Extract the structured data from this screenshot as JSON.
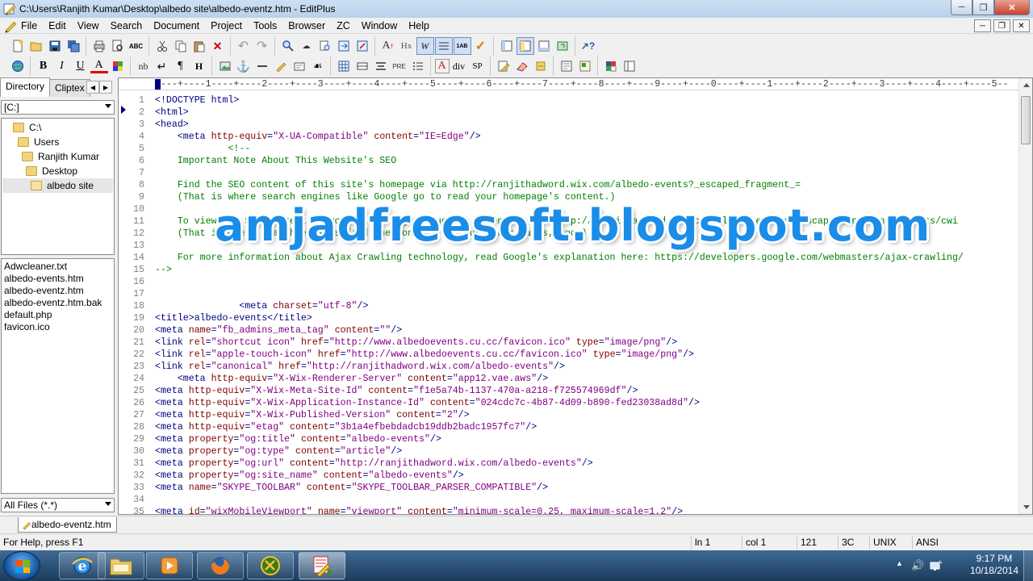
{
  "window": {
    "title": "C:\\Users\\Ranjith Kumar\\Desktop\\albedo site\\albedo-eventz.htm - EditPlus"
  },
  "menu": [
    "File",
    "Edit",
    "View",
    "Search",
    "Document",
    "Project",
    "Tools",
    "Browser",
    "ZC",
    "Window",
    "Help"
  ],
  "toolbar2_text": {
    "bold": "B",
    "italic": "I",
    "underline": "U",
    "font_color": "A",
    "nbsp": "nb",
    "br": "↵",
    "para": "¶",
    "heading": "H",
    "pre": "PRE",
    "div": "div",
    "span": "SP",
    "heading_a": "A",
    "hx": "Hx"
  },
  "left_panel": {
    "tabs": [
      "Directory",
      "Cliptex"
    ],
    "drive": "[C:]",
    "tree": [
      {
        "label": "C:\\",
        "level": 0
      },
      {
        "label": "Users",
        "level": 1
      },
      {
        "label": "Ranjith Kumar",
        "level": 2
      },
      {
        "label": "Desktop",
        "level": 3
      },
      {
        "label": "albedo site",
        "level": 4,
        "selected": true
      }
    ],
    "files": [
      "Adwcleaner.txt",
      "albedo-events.htm",
      "albedo-eventz.htm",
      "albedo-eventz.htm.bak",
      "default.php",
      "favicon.ico"
    ],
    "filter": "All Files (*.*)"
  },
  "editor": {
    "ruler": "----+----1----+----2----+----3----+----4----+----5----+----6----+----7----+----8----+----9----+----0----+----1----+----2----+----3----+----4----+----5--",
    "lines": [
      {
        "n": "1",
        "segs": [
          [
            "tag",
            "<!DOCTYPE html>"
          ]
        ]
      },
      {
        "n": "2",
        "segs": [
          [
            "tag",
            "<html>"
          ]
        ]
      },
      {
        "n": "3",
        "segs": [
          [
            "tag",
            "<head>"
          ]
        ]
      },
      {
        "n": "4",
        "segs": [
          [
            "txt",
            "    "
          ],
          [
            "tag",
            "<meta "
          ],
          [
            "attr",
            "http-equiv"
          ],
          [
            "tag",
            "="
          ],
          [
            "val",
            "\"X-UA-Compatible\""
          ],
          [
            "tag",
            " "
          ],
          [
            "attr",
            "content"
          ],
          [
            "tag",
            "="
          ],
          [
            "val",
            "\"IE=Edge\""
          ],
          [
            "tag",
            "/>"
          ]
        ]
      },
      {
        "n": "5",
        "segs": [
          [
            "com",
            "             <!--"
          ]
        ]
      },
      {
        "n": "6",
        "segs": [
          [
            "com",
            "    Important Note About This Website's SEO"
          ]
        ]
      },
      {
        "n": "7",
        "segs": [
          [
            "com",
            ""
          ]
        ]
      },
      {
        "n": "8",
        "segs": [
          [
            "com",
            "    Find the SEO content of this site's homepage via http://ranjithadword.wix.com/albedo-events?_escaped_fragment_="
          ]
        ]
      },
      {
        "n": "9",
        "segs": [
          [
            "com",
            "    (That is where search engines like Google go to read your homepage's content.)"
          ]
        ]
      },
      {
        "n": "10",
        "segs": [
          [
            "com",
            ""
          ]
        ]
      },
      {
        "n": "11",
        "segs": [
          [
            "com",
            "    To view the SEO content of your other pages, such as \"Events\", use http://ranjithadword.wix.com/albedo-events?_escaped_fragment_=events/cwi"
          ]
        ]
      },
      {
        "n": "12",
        "segs": [
          [
            "com",
            "    (That is where search engines find the content of your other pages, too.)"
          ]
        ]
      },
      {
        "n": "13",
        "segs": [
          [
            "com",
            ""
          ]
        ]
      },
      {
        "n": "14",
        "segs": [
          [
            "com",
            "    For more information about Ajax Crawling technology, read Google's explanation here: https://developers.google.com/webmasters/ajax-crawling/"
          ]
        ]
      },
      {
        "n": "15",
        "segs": [
          [
            "com",
            "-->"
          ]
        ]
      },
      {
        "n": "16",
        "segs": [
          [
            "txt",
            ""
          ]
        ]
      },
      {
        "n": "17",
        "segs": [
          [
            "txt",
            ""
          ]
        ]
      },
      {
        "n": "18",
        "segs": [
          [
            "txt",
            "               "
          ],
          [
            "tag",
            "<meta "
          ],
          [
            "attr",
            "charset"
          ],
          [
            "tag",
            "="
          ],
          [
            "val",
            "\"utf-8\""
          ],
          [
            "tag",
            "/>"
          ]
        ]
      },
      {
        "n": "19",
        "segs": [
          [
            "tag",
            "<title>"
          ],
          [
            "txt",
            "albedo-events"
          ],
          [
            "tag",
            "</title>"
          ]
        ]
      },
      {
        "n": "20",
        "segs": [
          [
            "tag",
            "<meta "
          ],
          [
            "attr",
            "name"
          ],
          [
            "tag",
            "="
          ],
          [
            "val",
            "\"fb_admins_meta_tag\""
          ],
          [
            "tag",
            " "
          ],
          [
            "attr",
            "content"
          ],
          [
            "tag",
            "="
          ],
          [
            "val",
            "\"\""
          ],
          [
            "tag",
            "/>"
          ]
        ]
      },
      {
        "n": "21",
        "segs": [
          [
            "tag",
            "<link "
          ],
          [
            "attr",
            "rel"
          ],
          [
            "tag",
            "="
          ],
          [
            "val",
            "\"shortcut icon\""
          ],
          [
            "tag",
            " "
          ],
          [
            "attr",
            "href"
          ],
          [
            "tag",
            "="
          ],
          [
            "val",
            "\"http://www.albedoevents.cu.cc/favicon.ico\""
          ],
          [
            "tag",
            " "
          ],
          [
            "attr",
            "type"
          ],
          [
            "tag",
            "="
          ],
          [
            "val",
            "\"image/png\""
          ],
          [
            "tag",
            "/>"
          ]
        ]
      },
      {
        "n": "22",
        "segs": [
          [
            "tag",
            "<link "
          ],
          [
            "attr",
            "rel"
          ],
          [
            "tag",
            "="
          ],
          [
            "val",
            "\"apple-touch-icon\""
          ],
          [
            "tag",
            " "
          ],
          [
            "attr",
            "href"
          ],
          [
            "tag",
            "="
          ],
          [
            "val",
            "\"http://www.albedoevents.cu.cc/favicon.ico\""
          ],
          [
            "tag",
            " "
          ],
          [
            "attr",
            "type"
          ],
          [
            "tag",
            "="
          ],
          [
            "val",
            "\"image/png\""
          ],
          [
            "tag",
            "/>"
          ]
        ]
      },
      {
        "n": "23",
        "segs": [
          [
            "tag",
            "<link "
          ],
          [
            "attr",
            "rel"
          ],
          [
            "tag",
            "="
          ],
          [
            "val",
            "\"canonical\""
          ],
          [
            "tag",
            " "
          ],
          [
            "attr",
            "href"
          ],
          [
            "tag",
            "="
          ],
          [
            "val",
            "\"http://ranjithadword.wix.com/albedo-events\""
          ],
          [
            "tag",
            "/>"
          ]
        ]
      },
      {
        "n": "24",
        "segs": [
          [
            "txt",
            "    "
          ],
          [
            "tag",
            "<meta "
          ],
          [
            "attr",
            "http-equiv"
          ],
          [
            "tag",
            "="
          ],
          [
            "val",
            "\"X-Wix-Renderer-Server\""
          ],
          [
            "tag",
            " "
          ],
          [
            "attr",
            "content"
          ],
          [
            "tag",
            "="
          ],
          [
            "val",
            "\"app12.vae.aws\""
          ],
          [
            "tag",
            "/>"
          ]
        ]
      },
      {
        "n": "25",
        "segs": [
          [
            "tag",
            "<meta "
          ],
          [
            "attr",
            "http-equiv"
          ],
          [
            "tag",
            "="
          ],
          [
            "val",
            "\"X-Wix-Meta-Site-Id\""
          ],
          [
            "tag",
            " "
          ],
          [
            "attr",
            "content"
          ],
          [
            "tag",
            "="
          ],
          [
            "val",
            "\"f1e5a74b-1137-470a-a218-f725574969df\""
          ],
          [
            "tag",
            "/>"
          ]
        ]
      },
      {
        "n": "26",
        "segs": [
          [
            "tag",
            "<meta "
          ],
          [
            "attr",
            "http-equiv"
          ],
          [
            "tag",
            "="
          ],
          [
            "val",
            "\"X-Wix-Application-Instance-Id\""
          ],
          [
            "tag",
            " "
          ],
          [
            "attr",
            "content"
          ],
          [
            "tag",
            "="
          ],
          [
            "val",
            "\"024cdc7c-4b87-4d09-b890-fed23038ad8d\""
          ],
          [
            "tag",
            "/>"
          ]
        ]
      },
      {
        "n": "27",
        "segs": [
          [
            "tag",
            "<meta "
          ],
          [
            "attr",
            "http-equiv"
          ],
          [
            "tag",
            "="
          ],
          [
            "val",
            "\"X-Wix-Published-Version\""
          ],
          [
            "tag",
            " "
          ],
          [
            "attr",
            "content"
          ],
          [
            "tag",
            "="
          ],
          [
            "val",
            "\"2\""
          ],
          [
            "tag",
            "/>"
          ]
        ]
      },
      {
        "n": "28",
        "segs": [
          [
            "tag",
            "<meta "
          ],
          [
            "attr",
            "http-equiv"
          ],
          [
            "tag",
            "="
          ],
          [
            "val",
            "\"etag\""
          ],
          [
            "tag",
            " "
          ],
          [
            "attr",
            "content"
          ],
          [
            "tag",
            "="
          ],
          [
            "val",
            "\"3b1a4efbebdadcb19ddb2badc1957fc7\""
          ],
          [
            "tag",
            "/>"
          ]
        ]
      },
      {
        "n": "29",
        "segs": [
          [
            "tag",
            "<meta "
          ],
          [
            "attr",
            "property"
          ],
          [
            "tag",
            "="
          ],
          [
            "val",
            "\"og:title\""
          ],
          [
            "tag",
            " "
          ],
          [
            "attr",
            "content"
          ],
          [
            "tag",
            "="
          ],
          [
            "val",
            "\"albedo-events\""
          ],
          [
            "tag",
            "/>"
          ]
        ]
      },
      {
        "n": "30",
        "segs": [
          [
            "tag",
            "<meta "
          ],
          [
            "attr",
            "property"
          ],
          [
            "tag",
            "="
          ],
          [
            "val",
            "\"og:type\""
          ],
          [
            "tag",
            " "
          ],
          [
            "attr",
            "content"
          ],
          [
            "tag",
            "="
          ],
          [
            "val",
            "\"article\""
          ],
          [
            "tag",
            "/>"
          ]
        ]
      },
      {
        "n": "31",
        "segs": [
          [
            "tag",
            "<meta "
          ],
          [
            "attr",
            "property"
          ],
          [
            "tag",
            "="
          ],
          [
            "val",
            "\"og:url\""
          ],
          [
            "tag",
            " "
          ],
          [
            "attr",
            "content"
          ],
          [
            "tag",
            "="
          ],
          [
            "val",
            "\"http://ranjithadword.wix.com/albedo-events\""
          ],
          [
            "tag",
            "/>"
          ]
        ]
      },
      {
        "n": "32",
        "segs": [
          [
            "tag",
            "<meta "
          ],
          [
            "attr",
            "property"
          ],
          [
            "tag",
            "="
          ],
          [
            "val",
            "\"og:site_name\""
          ],
          [
            "tag",
            " "
          ],
          [
            "attr",
            "content"
          ],
          [
            "tag",
            "="
          ],
          [
            "val",
            "\"albedo-events\""
          ],
          [
            "tag",
            "/>"
          ]
        ]
      },
      {
        "n": "33",
        "segs": [
          [
            "tag",
            "<meta "
          ],
          [
            "attr",
            "name"
          ],
          [
            "tag",
            "="
          ],
          [
            "val",
            "\"SKYPE_TOOLBAR\""
          ],
          [
            "tag",
            " "
          ],
          [
            "attr",
            "content"
          ],
          [
            "tag",
            "="
          ],
          [
            "val",
            "\"SKYPE_TOOLBAR_PARSER_COMPATIBLE\""
          ],
          [
            "tag",
            "/>"
          ]
        ]
      },
      {
        "n": "34",
        "segs": [
          [
            "txt",
            ""
          ]
        ]
      },
      {
        "n": "35",
        "segs": [
          [
            "tag",
            "<meta "
          ],
          [
            "attr",
            "id"
          ],
          [
            "tag",
            "="
          ],
          [
            "val",
            "\"wixMobileViewport\""
          ],
          [
            "tag",
            " "
          ],
          [
            "attr",
            "name"
          ],
          [
            "tag",
            "="
          ],
          [
            "val",
            "\"viewport\""
          ],
          [
            "tag",
            " "
          ],
          [
            "attr",
            "content"
          ],
          [
            "tag",
            "="
          ],
          [
            "val",
            "\"minimum-scale=0.25, maximum-scale=1.2\""
          ],
          [
            "tag",
            "/>"
          ]
        ]
      }
    ]
  },
  "watermark": "amjadfreesoft.blogspot.com",
  "doc_tab": "albedo-eventz.htm",
  "status": {
    "help": "For Help, press F1",
    "line": "ln 1",
    "col": "col 1",
    "chars": "121",
    "hex": "3C",
    "eol": "UNIX",
    "encoding": "ANSI"
  },
  "taskbar": {
    "time": "9:17 PM",
    "date": "10/18/2014"
  },
  "colors": {
    "tag": "#000080",
    "attr": "#800000",
    "value": "#800080",
    "comment": "#008000",
    "watermark": "#1a8de8"
  }
}
